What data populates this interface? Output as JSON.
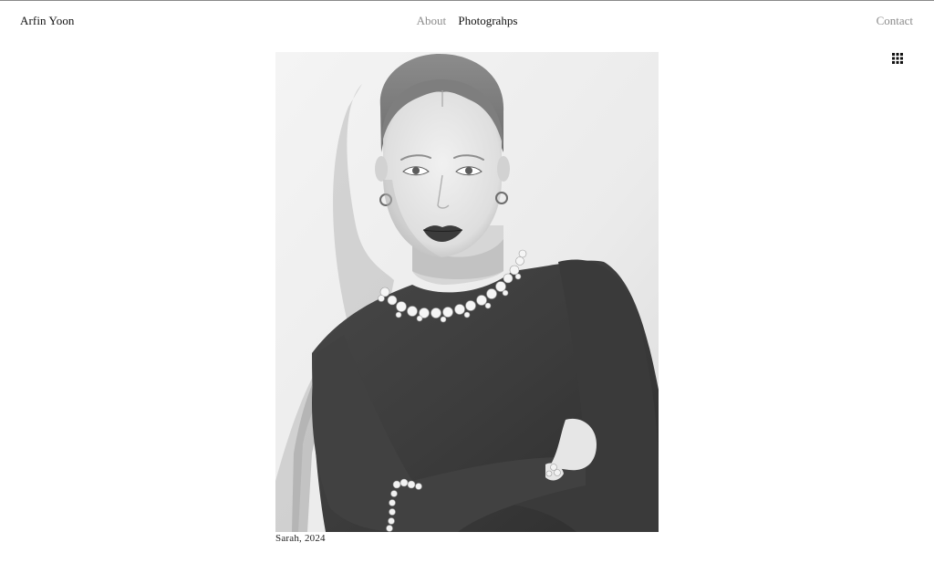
{
  "header": {
    "brand": "Arfin Yoon",
    "nav": [
      {
        "label": "About",
        "active": false
      },
      {
        "label": "Photograhps",
        "active": true
      }
    ],
    "contact": "Contact"
  },
  "toolbar": {
    "grid_icon": "grid-view-icon"
  },
  "photo": {
    "caption": "Sarah, 2024",
    "tone": "black-and-white"
  },
  "colors": {
    "background": "#ffffff",
    "text": "#111111",
    "muted": "#8c8c8c"
  }
}
